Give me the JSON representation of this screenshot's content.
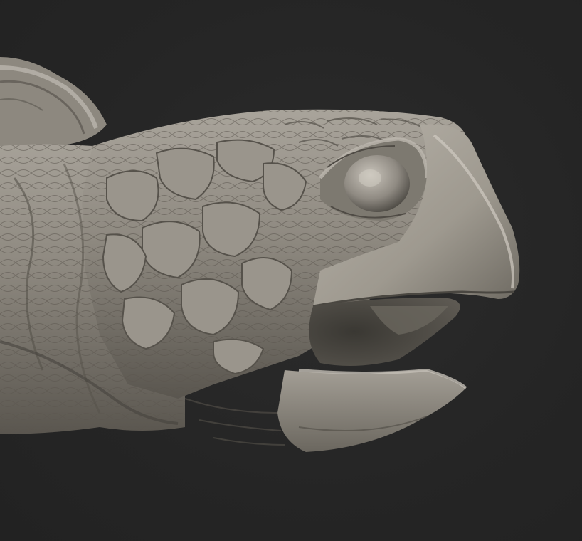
{
  "scene": {
    "background_color": "#262626",
    "model_base_color": "#8f8a82",
    "model_highlight_color": "#c9c4bb",
    "model_shadow_color": "#4a4741",
    "subject": "turtle-head-sculpt"
  }
}
